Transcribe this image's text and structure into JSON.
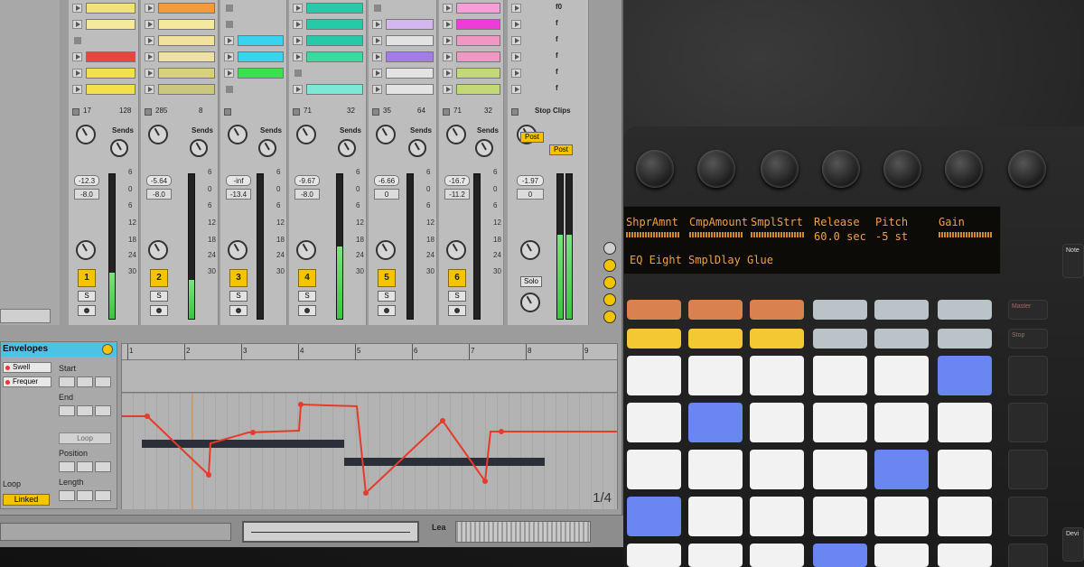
{
  "tracks": [
    {
      "id": 1,
      "header": [
        "17",
        "128"
      ],
      "vol": "-12.3",
      "pan": "-8.0",
      "num": "1",
      "s": "S",
      "level": 0.32,
      "clips": [
        "#f2e27a",
        "#f5e9a0",
        "#d8d8d8",
        "#e5483a",
        "#f4e04a",
        "#f4e04a"
      ]
    },
    {
      "id": 2,
      "header": [
        "285",
        "8"
      ],
      "vol": "-5.64",
      "pan": "-8.0",
      "num": "2",
      "s": "S",
      "level": 0.27,
      "clips": [
        "#f39a3a",
        "#f5e9a0",
        "#f1e2a0",
        "#efe2a0",
        "#d9d07a",
        "#cbc680"
      ]
    },
    {
      "id": 3,
      "header": [
        "",
        ""
      ],
      "vol": "-inf",
      "pan": "-13.4",
      "num": "3",
      "s": "S",
      "level": 0.0,
      "clips": [
        "#d8d8d8",
        "#d8d8d8",
        "#3ad3ef",
        "#3ad3ef",
        "#38e24a",
        "#d8d8d8"
      ]
    },
    {
      "id": 4,
      "header": [
        "71",
        "32"
      ],
      "vol": "-9.67",
      "pan": "-8.0",
      "num": "4",
      "s": "S",
      "level": 0.5,
      "clips": [
        "#26c9a8",
        "#26c9a8",
        "#26c9a8",
        "#3ad9a0",
        "#d8d8d8",
        "#7ee8d6"
      ]
    },
    {
      "id": 5,
      "header": [
        "35",
        "64"
      ],
      "vol": "-6.66",
      "pan": "0",
      "num": "5",
      "s": "S",
      "level": 0.0,
      "clips": [
        "#d8d8d8",
        "#d5b7ef",
        "#e2e2e2",
        "#a47ce6",
        "#e3e3e3",
        "#e3e3e3"
      ]
    },
    {
      "id": 6,
      "header": [
        "71",
        "32"
      ],
      "vol": "-16.7",
      "pan": "-11.2",
      "num": "6",
      "s": "S",
      "level": 0.0,
      "clips": [
        "#f4a0d8",
        "#ee3cd6",
        "#f296c4",
        "#f296c4",
        "#c3d977",
        "#c3d977"
      ]
    }
  ],
  "master": {
    "stop_all": "Stop Clips",
    "post": "Post",
    "post2": "Post",
    "vol": "-1.97",
    "pan": "0",
    "solo": "Solo",
    "level": 0.58,
    "scenes": [
      "f0",
      "f",
      "f",
      "f",
      "f",
      "f"
    ]
  },
  "scale_labels": [
    "6",
    "0",
    "6",
    "12",
    "18",
    "24",
    "30",
    "36",
    "48"
  ],
  "sends_label": "Sends",
  "envelopes": {
    "title": "Envelopes",
    "dropdown1": "Swell",
    "dropdown2": "Frequer",
    "start": "Start",
    "end": "End",
    "loop_button": "Loop",
    "position": "Position",
    "length": "Length",
    "loop_label": "Loop",
    "linked": "Linked"
  },
  "editor": {
    "ticks": [
      "1",
      "2",
      "3",
      "4",
      "5",
      "6",
      "7",
      "8",
      "9"
    ],
    "page": "1/4"
  },
  "bottom": {
    "lead_label": "Lea"
  },
  "device": {
    "oled_top": [
      "ShprAmnt",
      "CmpAmount",
      "SmplStrt",
      "Release",
      "Pitch",
      "Gain"
    ],
    "oled_vals": [
      "",
      "",
      "",
      "60.0 sec",
      "-5 st",
      ""
    ],
    "oled_bottom": "EQ Eight SmplDlay Glue",
    "side_labels": [
      "Master",
      "Stop",
      "",
      "",
      "",
      "",
      ""
    ],
    "right_labels": [
      "Note",
      "Devi"
    ],
    "pad_rows": [
      [
        "#d9814f",
        "#d9814f",
        "#d9814f",
        "#b9c3c8",
        "#b9c3c8",
        "#b9c3c8"
      ],
      [
        "#f4c832",
        "#f4c832",
        "#f4c832",
        "#b9c3c8",
        "#b9c3c8",
        "#b9c3c8"
      ],
      [
        "#f2f2f2",
        "#f2f2f2",
        "#f2f2f2",
        "#f2f2f2",
        "#f2f2f2",
        "#6a86f0"
      ],
      [
        "#f2f2f2",
        "#6a86f0",
        "#f2f2f2",
        "#f2f2f2",
        "#f2f2f2",
        "#f2f2f2"
      ],
      [
        "#f2f2f2",
        "#f2f2f2",
        "#f2f2f2",
        "#f2f2f2",
        "#6a86f0",
        "#f2f2f2"
      ],
      [
        "#6a86f0",
        "#f2f2f2",
        "#f2f2f2",
        "#f2f2f2",
        "#f2f2f2",
        "#f2f2f2"
      ],
      [
        "#f2f2f2",
        "#f2f2f2",
        "#f2f2f2",
        "#6a86f0",
        "#f2f2f2",
        "#f2f2f2"
      ]
    ]
  }
}
